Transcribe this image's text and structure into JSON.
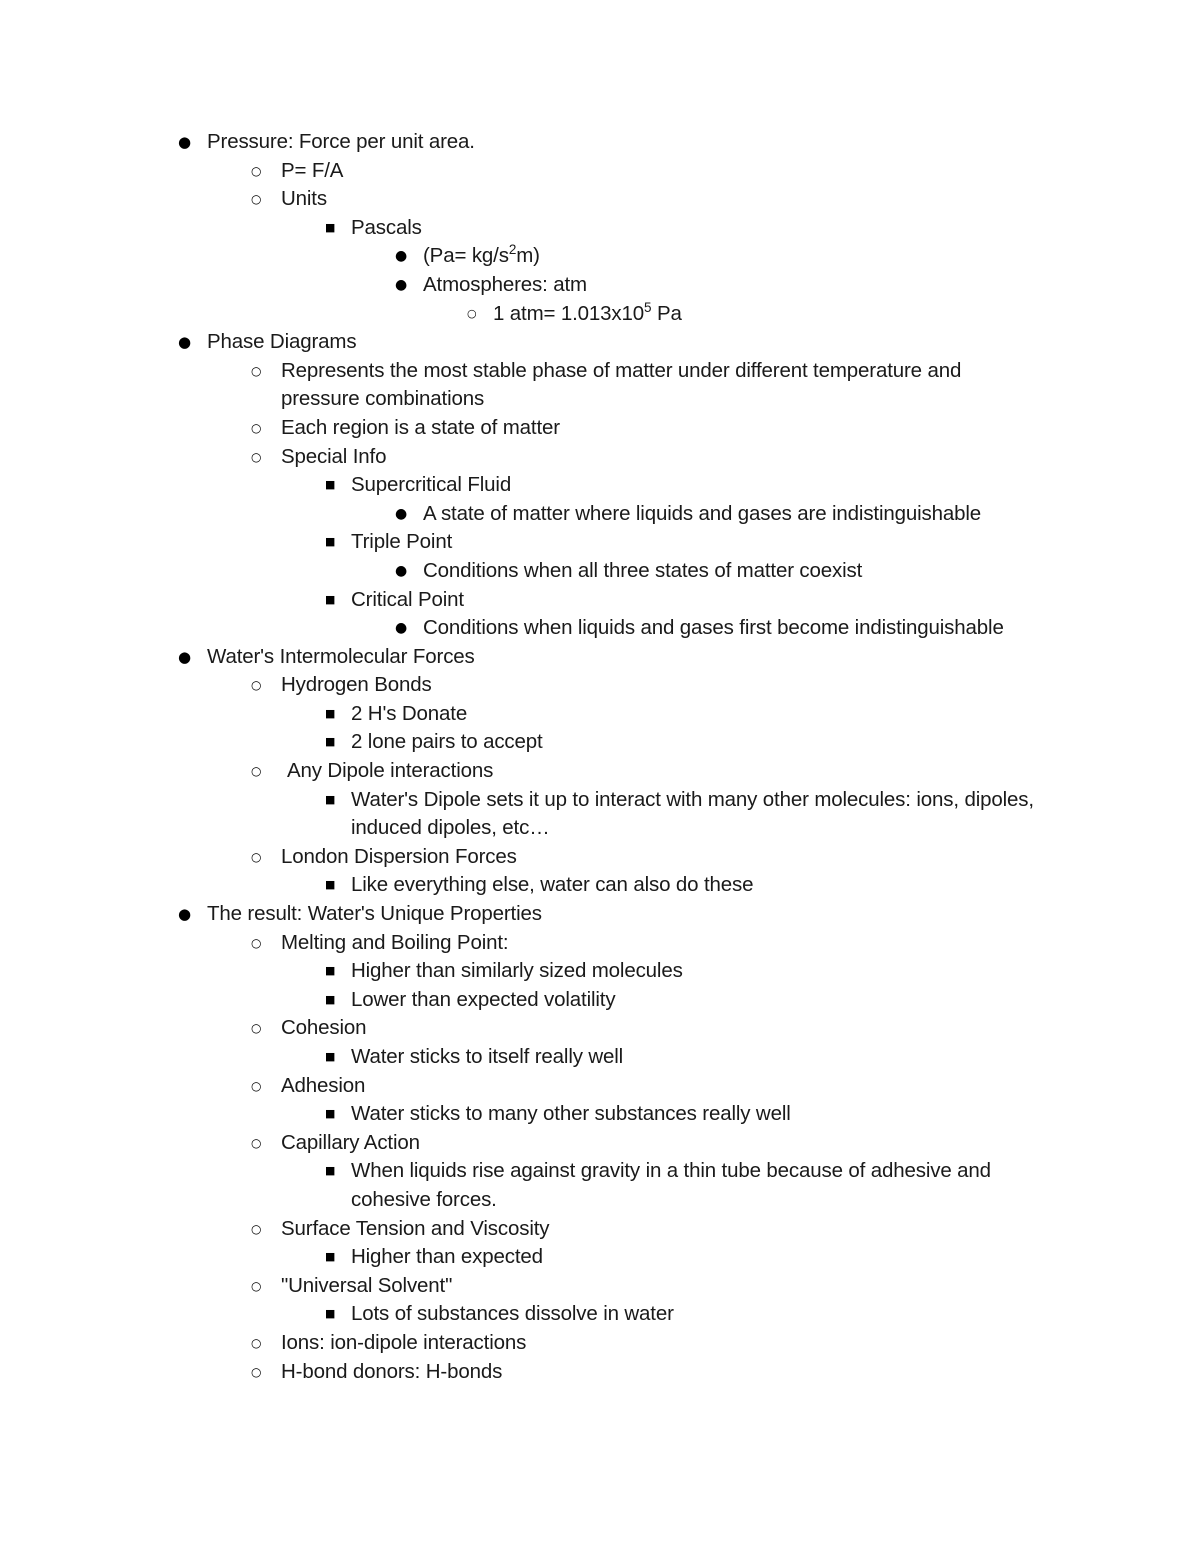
{
  "document": {
    "bullet_glyphs": {
      "level1": "●",
      "level2": "○",
      "level3": "■",
      "level4": "●",
      "level5": "○"
    },
    "text_color": "#1a1a1a",
    "background_color": "#ffffff",
    "outline": [
      {
        "level": 1,
        "text": "Pressure: Force per unit area."
      },
      {
        "level": 2,
        "text": "P= F/A"
      },
      {
        "level": 2,
        "text": "Units"
      },
      {
        "level": 3,
        "text": "Pascals"
      },
      {
        "level": 4,
        "text": "(Pa= kg/s²m)",
        "html": "(Pa= kg/s<sup>2</sup>m)"
      },
      {
        "level": 4,
        "text": "Atmospheres: atm"
      },
      {
        "level": 5,
        "text": "1 atm= 1.013x10⁵ Pa",
        "html": "1 atm= 1.013x10<sup>5</sup> Pa"
      },
      {
        "level": 1,
        "text": "Phase Diagrams"
      },
      {
        "level": 2,
        "text": "Represents the most stable phase of matter under different temperature and pressure combinations"
      },
      {
        "level": 2,
        "text": "Each region is a state of matter"
      },
      {
        "level": 2,
        "text": "Special Info"
      },
      {
        "level": 3,
        "text": "Supercritical Fluid"
      },
      {
        "level": 4,
        "text": "A state of matter where liquids and gases are indistinguishable"
      },
      {
        "level": 3,
        "text": "Triple Point"
      },
      {
        "level": 4,
        "text": "Conditions when all three states of matter coexist"
      },
      {
        "level": 3,
        "text": "Critical Point"
      },
      {
        "level": 4,
        "text": "Conditions when liquids and gases first become indistinguishable"
      },
      {
        "level": 1,
        "text": "Water's Intermolecular Forces"
      },
      {
        "level": 2,
        "text": "Hydrogen Bonds"
      },
      {
        "level": 3,
        "text": "2 H's Donate"
      },
      {
        "level": 3,
        "text": "2 lone pairs to accept"
      },
      {
        "level": 2,
        "text": "Any Dipole interactions",
        "extra_gap": true
      },
      {
        "level": 3,
        "text": "Water's Dipole sets it up to interact with many other molecules: ions, dipoles, induced dipoles, etc…"
      },
      {
        "level": 2,
        "text": "London Dispersion Forces"
      },
      {
        "level": 3,
        "text": "Like everything else, water can also do these"
      },
      {
        "level": 1,
        "text": "The result: Water's Unique Properties"
      },
      {
        "level": 2,
        "text": "Melting and Boiling Point:"
      },
      {
        "level": 3,
        "text": "Higher than similarly sized molecules"
      },
      {
        "level": 3,
        "text": "Lower than expected volatility"
      },
      {
        "level": 2,
        "text": "Cohesion"
      },
      {
        "level": 3,
        "text": "Water sticks to itself really well"
      },
      {
        "level": 2,
        "text": "Adhesion"
      },
      {
        "level": 3,
        "text": "Water sticks to many other substances really well"
      },
      {
        "level": 2,
        "text": "Capillary Action"
      },
      {
        "level": 3,
        "text": "When liquids rise against gravity in a thin tube because of adhesive and cohesive forces."
      },
      {
        "level": 2,
        "text": "Surface Tension and Viscosity"
      },
      {
        "level": 3,
        "text": "Higher than expected"
      },
      {
        "level": 2,
        "text": "\"Universal Solvent\""
      },
      {
        "level": 3,
        "text": "Lots of substances dissolve in water"
      },
      {
        "level": 2,
        "text": "Ions: ion-dipole interactions"
      },
      {
        "level": 2,
        "text": "H-bond donors: H-bonds"
      }
    ]
  }
}
